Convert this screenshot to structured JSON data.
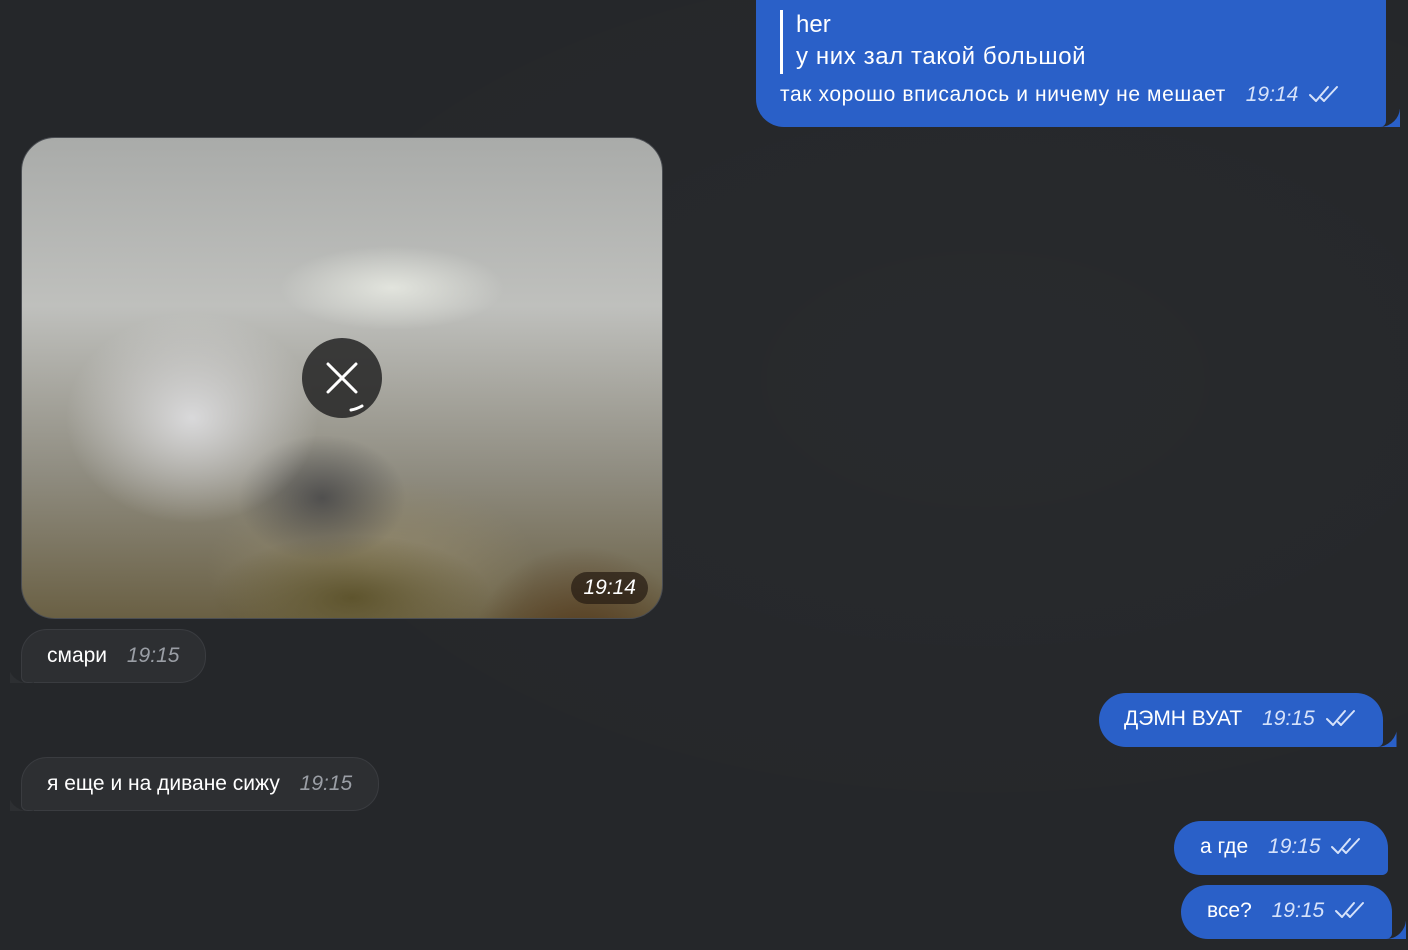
{
  "messages": {
    "reply_msg": {
      "quote_author": "her",
      "quote_text": "у них зал такой большой",
      "text": "так хорошо вписалось и ничему не мешает",
      "time": "19:14"
    },
    "media_msg": {
      "time": "19:14"
    },
    "smari": {
      "text": "смари",
      "time": "19:15"
    },
    "damn": {
      "text": "ДЭМН ВУАТ",
      "time": "19:15"
    },
    "divan": {
      "text": "я еще и на диване сижу",
      "time": "19:15"
    },
    "agde": {
      "text": "а где",
      "time": "19:15"
    },
    "vse": {
      "text": "все?",
      "time": "19:15"
    }
  },
  "colors": {
    "background": "#25272a",
    "outgoing_bubble": "#2a60c8",
    "incoming_bubble": "#2d2f32"
  },
  "icons": {
    "read_status": "double-check-icon",
    "cancel_download": "close-icon"
  }
}
